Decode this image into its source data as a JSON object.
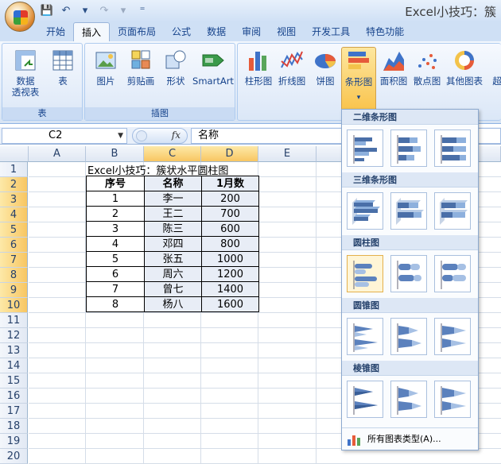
{
  "window": {
    "title": "Excel小技巧：簇"
  },
  "tabs": [
    "开始",
    "插入",
    "页面布局",
    "公式",
    "数据",
    "审阅",
    "视图",
    "开发工具",
    "特色功能"
  ],
  "ribbon": {
    "groups": {
      "table": "表",
      "illustrations": "插图"
    },
    "buttons": {
      "pivot": "数据\n透视表",
      "pivot_dd": "▾",
      "table": "表",
      "picture": "图片",
      "clipart": "剪贴画",
      "shapes": "形状",
      "smartart": "SmartArt",
      "column": "柱形图",
      "line": "折线图",
      "pie": "饼图",
      "bar": "条形图",
      "area": "面积图",
      "scatter": "散点图",
      "other": "其他图表",
      "more": "超"
    }
  },
  "formula_bar": {
    "name_box": "C2",
    "fx": "fx",
    "value": "名称"
  },
  "sheet": {
    "columns": [
      "A",
      "B",
      "C",
      "D",
      "E"
    ],
    "rows": [
      "1",
      "2",
      "3",
      "4",
      "5",
      "6",
      "7",
      "8",
      "9",
      "10",
      "11",
      "12",
      "13",
      "14",
      "15",
      "16",
      "17",
      "18",
      "19",
      "20"
    ],
    "title": "Excel小技巧：簇状水平圆柱图",
    "headers": [
      "序号",
      "名称",
      "1月数"
    ],
    "data": [
      [
        "1",
        "李一",
        "200"
      ],
      [
        "2",
        "王二",
        "700"
      ],
      [
        "3",
        "陈三",
        "600"
      ],
      [
        "4",
        "邓四",
        "800"
      ],
      [
        "5",
        "张五",
        "1000"
      ],
      [
        "6",
        "周六",
        "1200"
      ],
      [
        "7",
        "曾七",
        "1400"
      ],
      [
        "8",
        "杨八",
        "1600"
      ]
    ]
  },
  "gallery": {
    "sections": [
      "二维条形图",
      "三维条形图",
      "圆柱图",
      "圆锥图",
      "棱锥图"
    ],
    "footer": "所有图表类型(A)..."
  },
  "colors": {
    "accent": "#f9c34b",
    "ribbon": "#dbe7f7",
    "header_selected": "#f8c662"
  }
}
